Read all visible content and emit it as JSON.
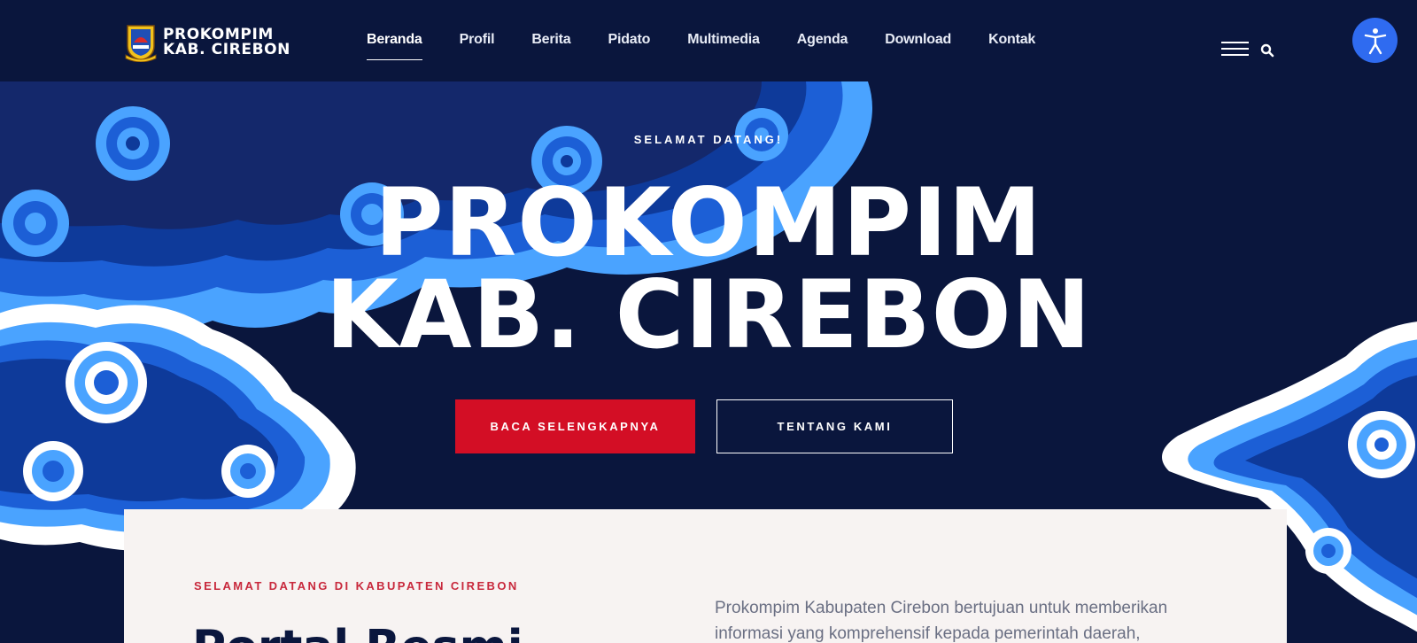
{
  "header": {
    "logo_line1": "PROKOMPIM",
    "logo_line2": "KAB. CIREBON",
    "nav": [
      {
        "label": "Beranda",
        "active": true
      },
      {
        "label": "Profil"
      },
      {
        "label": "Berita"
      },
      {
        "label": "Pidato"
      },
      {
        "label": "Multimedia"
      },
      {
        "label": "Agenda"
      },
      {
        "label": "Download"
      },
      {
        "label": "Kontak"
      }
    ],
    "icons": [
      "hamburger-menu-icon",
      "search-icon",
      "accessibility-icon"
    ]
  },
  "hero": {
    "kicker": "SELAMAT DATANG!",
    "title_line1": "PROKOMPIM",
    "title_line2": "KAB. CIREBON",
    "primary_button": "BACA SELENGKAPNYA",
    "secondary_button": "TENTANG KAMI"
  },
  "intro": {
    "kicker": "SELAMAT DATANG DI KABUPATEN CIREBON",
    "title": "Portal Resmi",
    "description": "Prokompim Kabupaten Cirebon bertujuan untuk memberikan informasi yang komprehensif kepada pemerintah daerah,"
  },
  "colors": {
    "background": "#0a163d",
    "accent_red": "#d30e25",
    "accessibility_blue": "#2f6bf0",
    "card_bg": "#f7f3f2",
    "kicker_red": "#c8283c"
  }
}
